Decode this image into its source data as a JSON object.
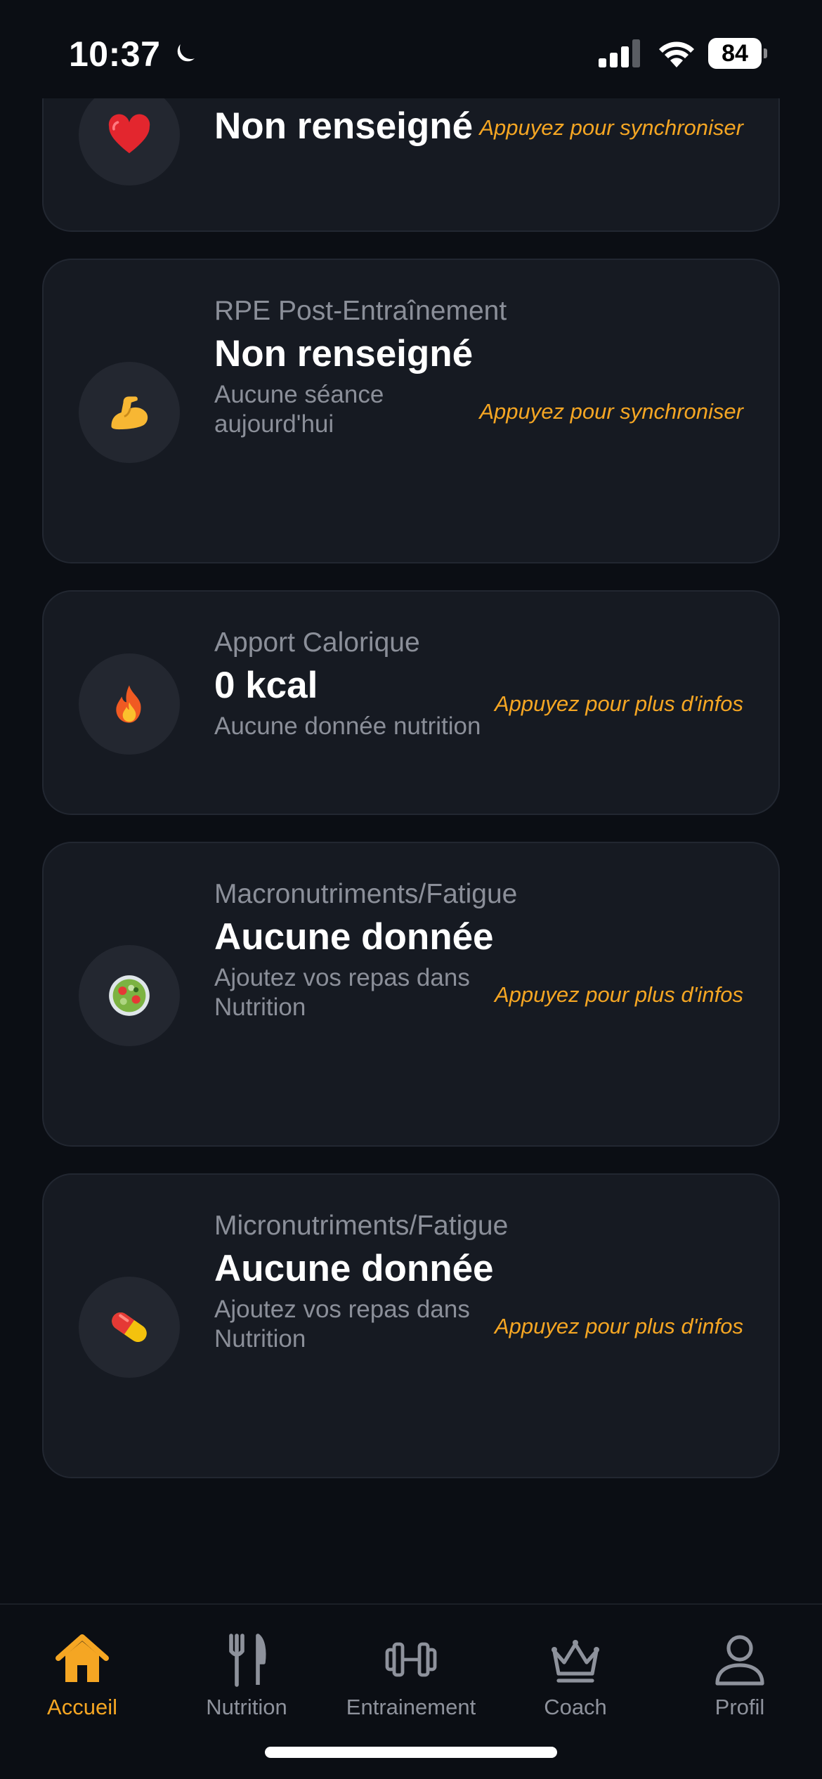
{
  "status_bar": {
    "time": "10:37",
    "battery": "84",
    "icons": [
      "moon-icon",
      "signal-icon",
      "wifi-icon",
      "battery-icon"
    ]
  },
  "cards": [
    {
      "icon": "heart-icon",
      "emoji": "❤️",
      "label": "",
      "value": "Non renseigné",
      "sub": "",
      "action": "Appuyez pour synchroniser"
    },
    {
      "icon": "flexed-biceps-icon",
      "emoji": "💪",
      "label": "RPE Post-Entraînement",
      "value": "Non renseigné",
      "sub": "Aucune séance aujourd'hui",
      "action": "Appuyez pour synchroniser"
    },
    {
      "icon": "fire-icon",
      "emoji": "🔥",
      "label": "Apport Calorique",
      "value": "0 kcal",
      "sub": "Aucune donnée nutrition",
      "action": "Appuyez pour plus d'infos"
    },
    {
      "icon": "salad-icon",
      "emoji": "🥗",
      "label": "Macronutriments/Fatigue",
      "value": "Aucune donnée",
      "sub": "Ajoutez vos repas dans Nutrition",
      "action": "Appuyez pour plus d'infos"
    },
    {
      "icon": "pill-icon",
      "emoji": "💊",
      "label": "Micronutriments/Fatigue",
      "value": "Aucune donnée",
      "sub": "Ajoutez vos repas dans Nutrition",
      "action": "Appuyez pour plus d'infos"
    }
  ],
  "tabs": [
    {
      "label": "Accueil",
      "icon": "home-icon",
      "active": true
    },
    {
      "label": "Nutrition",
      "icon": "fork-knife-icon",
      "active": false
    },
    {
      "label": "Entrainement",
      "icon": "dumbbell-icon",
      "active": false
    },
    {
      "label": "Coach",
      "icon": "crown-icon",
      "active": false
    },
    {
      "label": "Profil",
      "icon": "person-icon",
      "active": false
    }
  ],
  "colors": {
    "background": "#0b0e14",
    "card": "#161a22",
    "accent": "#f5a623",
    "muted_text": "#8b8f99"
  }
}
